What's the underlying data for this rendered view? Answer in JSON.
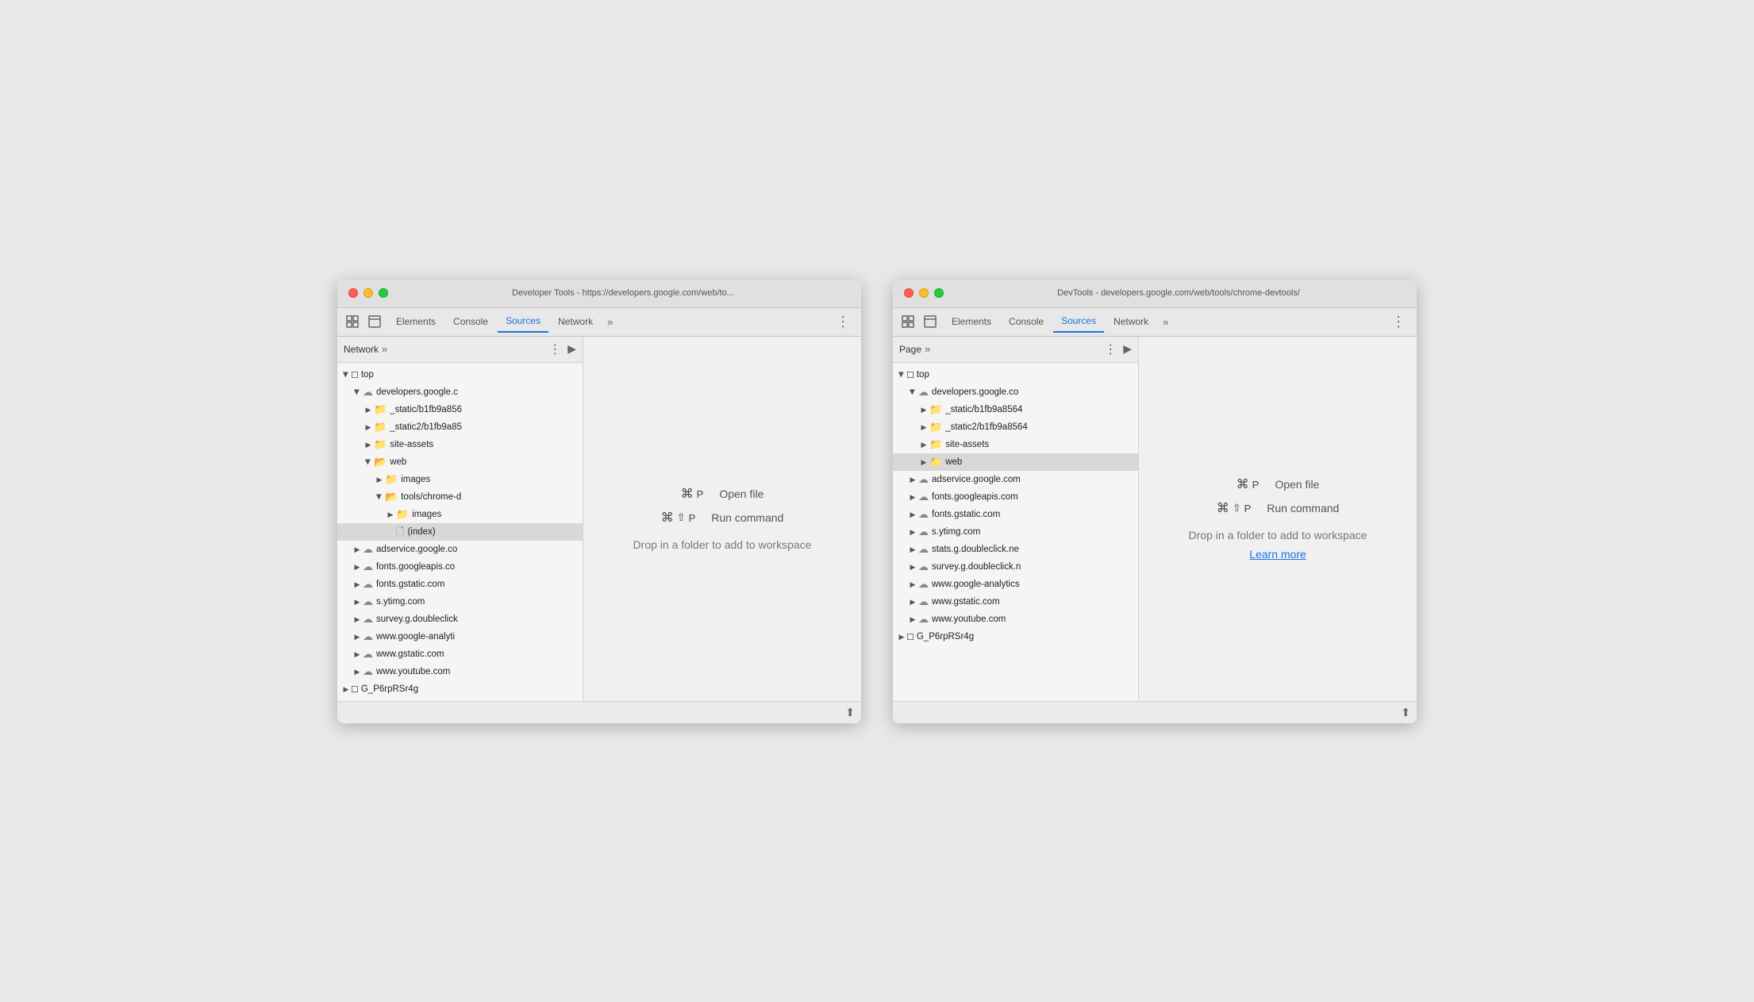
{
  "window1": {
    "title": "Developer Tools - https://developers.google.com/web/to...",
    "tabs": [
      "Elements",
      "Console",
      "Sources",
      "Network",
      "»",
      "⋮"
    ],
    "active_tab": "Sources",
    "sidebar_label": "Network",
    "sidebar_more": "»",
    "tree": [
      {
        "label": "top",
        "indent": 0,
        "type": "arrow-folder",
        "open": true
      },
      {
        "label": "developers.google.c",
        "indent": 1,
        "type": "cloud",
        "open": true
      },
      {
        "label": "_static/b1fb9a856",
        "indent": 2,
        "type": "folder",
        "open": false
      },
      {
        "label": "_static2/b1fb9a85",
        "indent": 2,
        "type": "folder",
        "open": false
      },
      {
        "label": "site-assets",
        "indent": 2,
        "type": "folder",
        "open": false
      },
      {
        "label": "web",
        "indent": 2,
        "type": "folder-open",
        "open": true
      },
      {
        "label": "images",
        "indent": 3,
        "type": "folder",
        "open": false
      },
      {
        "label": "tools/chrome-d",
        "indent": 3,
        "type": "folder-open",
        "open": true
      },
      {
        "label": "images",
        "indent": 4,
        "type": "folder",
        "open": false
      },
      {
        "label": "(index)",
        "indent": 4,
        "type": "file",
        "selected": true
      },
      {
        "label": "adservice.google.co",
        "indent": 1,
        "type": "cloud",
        "open": false
      },
      {
        "label": "fonts.googleapis.co",
        "indent": 1,
        "type": "cloud",
        "open": false
      },
      {
        "label": "fonts.gstatic.com",
        "indent": 1,
        "type": "cloud",
        "open": false
      },
      {
        "label": "s.ytimg.com",
        "indent": 1,
        "type": "cloud",
        "open": false
      },
      {
        "label": "survey.g.doubleclick",
        "indent": 1,
        "type": "cloud",
        "open": false
      },
      {
        "label": "www.google-analyti",
        "indent": 1,
        "type": "cloud",
        "open": false
      },
      {
        "label": "www.gstatic.com",
        "indent": 1,
        "type": "cloud",
        "open": false
      },
      {
        "label": "www.youtube.com",
        "indent": 1,
        "type": "cloud",
        "open": false
      },
      {
        "label": "G_P6rpRSr4g",
        "indent": 0,
        "type": "arrow-folder-closed"
      }
    ],
    "shortcuts": [
      {
        "keys": [
          "⌘",
          "P"
        ],
        "label": "Open file"
      },
      {
        "keys": [
          "⌘",
          "⇧",
          "P"
        ],
        "label": "Run command"
      }
    ],
    "drop_text": "Drop in a folder to add to workspace",
    "show_learn_more": false
  },
  "window2": {
    "title": "DevTools - developers.google.com/web/tools/chrome-devtools/",
    "tabs": [
      "Elements",
      "Console",
      "Sources",
      "Network",
      "»",
      "⋮"
    ],
    "active_tab": "Sources",
    "sidebar_label": "Page",
    "sidebar_more": "»",
    "tree": [
      {
        "label": "top",
        "indent": 0,
        "type": "arrow-folder",
        "open": true
      },
      {
        "label": "developers.google.co",
        "indent": 1,
        "type": "cloud",
        "open": true
      },
      {
        "label": "_static/b1fb9a8564",
        "indent": 2,
        "type": "folder",
        "open": false
      },
      {
        "label": "_static2/b1fb9a8564",
        "indent": 2,
        "type": "folder",
        "open": false
      },
      {
        "label": "site-assets",
        "indent": 2,
        "type": "folder",
        "open": false
      },
      {
        "label": "web",
        "indent": 2,
        "type": "folder",
        "open": false,
        "highlighted": true
      },
      {
        "label": "adservice.google.com",
        "indent": 1,
        "type": "cloud",
        "open": false
      },
      {
        "label": "fonts.googleapis.com",
        "indent": 1,
        "type": "cloud",
        "open": false
      },
      {
        "label": "fonts.gstatic.com",
        "indent": 1,
        "type": "cloud",
        "open": false
      },
      {
        "label": "s.ytimg.com",
        "indent": 1,
        "type": "cloud",
        "open": false
      },
      {
        "label": "stats.g.doubleclick.ne",
        "indent": 1,
        "type": "cloud",
        "open": false
      },
      {
        "label": "survey.g.doubleclick.n",
        "indent": 1,
        "type": "cloud",
        "open": false
      },
      {
        "label": "www.google-analytics",
        "indent": 1,
        "type": "cloud",
        "open": false
      },
      {
        "label": "www.gstatic.com",
        "indent": 1,
        "type": "cloud",
        "open": false
      },
      {
        "label": "www.youtube.com",
        "indent": 1,
        "type": "cloud",
        "open": false
      },
      {
        "label": "G_P6rpRSr4g",
        "indent": 0,
        "type": "arrow-folder-closed"
      }
    ],
    "shortcuts": [
      {
        "keys": [
          "⌘",
          "P"
        ],
        "label": "Open file"
      },
      {
        "keys": [
          "⌘",
          "⇧",
          "P"
        ],
        "label": "Run command"
      }
    ],
    "drop_text": "Drop in a folder to add to workspace",
    "learn_more_text": "Learn more",
    "show_learn_more": true
  }
}
